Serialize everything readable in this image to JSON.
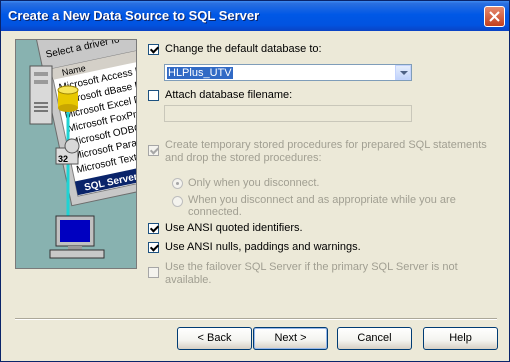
{
  "window": {
    "title": "Create a New Data Source to SQL Server"
  },
  "illustration": {
    "header": "Select a driver fo",
    "name_col": "Name",
    "drivers": [
      "Microsoft Access D",
      "Microsoft dBase Dr",
      "Microsoft Excel Dr",
      "Microsoft FoxPro V",
      "Microsoft ODBC fo",
      "Microsoft Paradox",
      "Microsoft Text",
      "SQL Server"
    ],
    "badge": "32"
  },
  "options": {
    "change_default_db": {
      "label": "Change the default database to:",
      "checked": true
    },
    "database_value": "HLPlus_UTV",
    "attach_db": {
      "label": "Attach database filename:",
      "checked": false
    },
    "attach_value": "",
    "create_temp": {
      "label_line1": "Create temporary stored procedures for prepared SQL statements",
      "label_line2": "and drop the stored procedures:",
      "checked": true,
      "disabled": true
    },
    "radio_disconnect": {
      "label": "Only when you disconnect.",
      "selected": true
    },
    "radio_appropriate": {
      "label_line1": "When you disconnect and as appropriate while you are",
      "label_line2": "connected.",
      "selected": false
    },
    "ansi_quoted": {
      "label": "Use ANSI quoted identifiers.",
      "checked": true
    },
    "ansi_nulls": {
      "label": "Use ANSI nulls, paddings and warnings.",
      "checked": true
    },
    "failover": {
      "label_line1": "Use the failover SQL Server if the primary SQL Server is not",
      "label_line2": "available.",
      "checked": false,
      "disabled": true
    }
  },
  "buttons": {
    "back": "< Back",
    "next": "Next >",
    "cancel": "Cancel",
    "help": "Help"
  }
}
